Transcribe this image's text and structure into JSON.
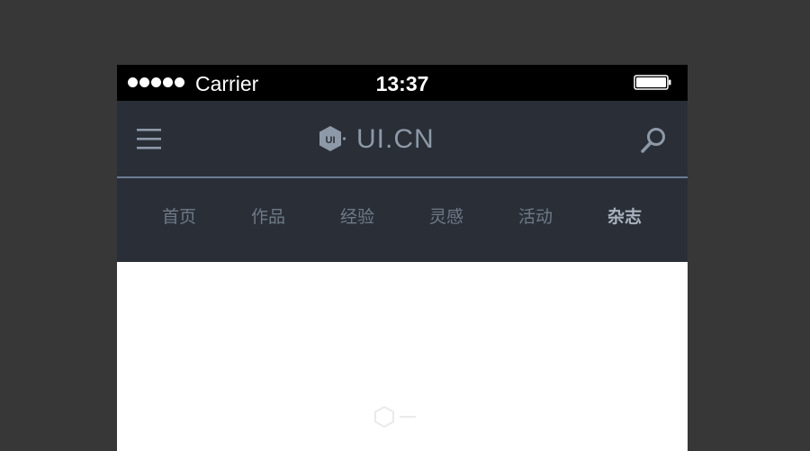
{
  "status_bar": {
    "carrier": "Carrier",
    "time": "13:37",
    "signal_dots": 5
  },
  "header": {
    "logo_mark_text": "UI",
    "logo_text": "UI.CN",
    "icons": [
      "menu-icon",
      "search-icon"
    ]
  },
  "tabs": [
    {
      "label": "首页",
      "active": false
    },
    {
      "label": "作品",
      "active": false
    },
    {
      "label": "经验",
      "active": false
    },
    {
      "label": "灵感",
      "active": false
    },
    {
      "label": "活动",
      "active": false
    },
    {
      "label": "杂志",
      "active": true
    }
  ],
  "colors": {
    "background": "#373737",
    "nav_background": "#2a2f37",
    "nav_divider": "#6b7c93",
    "tab_inactive": "#6f7987",
    "tab_active": "#a9b2be",
    "logo": "#8e99a8"
  }
}
